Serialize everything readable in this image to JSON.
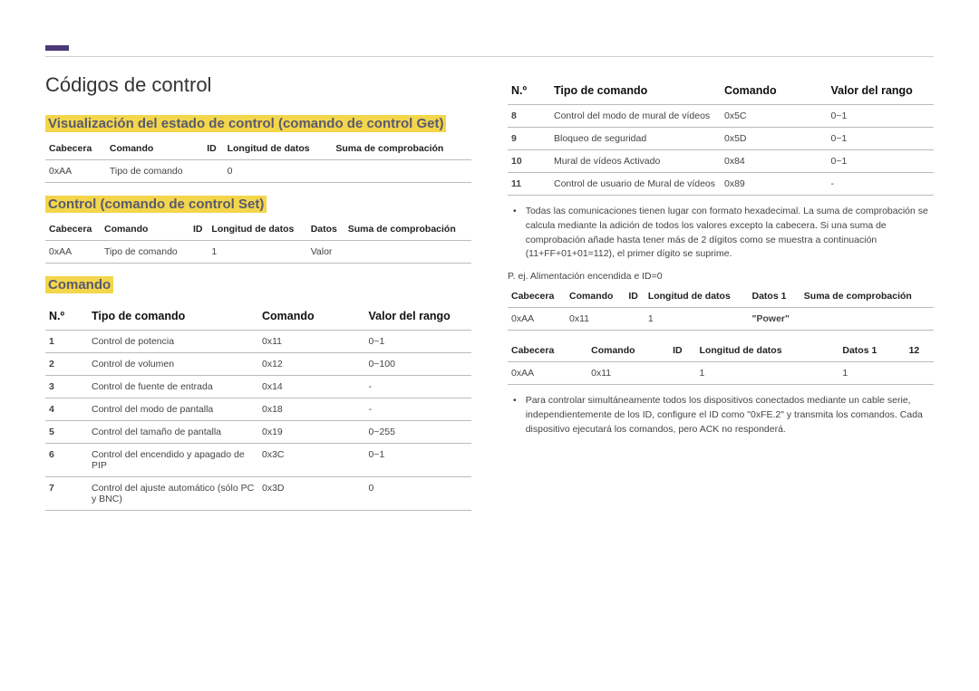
{
  "page_title": "Códigos de control",
  "section_get": {
    "title": "Visualización del estado de control (comando de control Get)",
    "headers": [
      "Cabecera",
      "Comando",
      "ID",
      "Longitud de datos",
      "Suma de comprobación"
    ],
    "row": [
      "0xAA",
      "Tipo de comando",
      "",
      "0",
      ""
    ]
  },
  "section_set": {
    "title": "Control (comando de control Set)",
    "headers": [
      "Cabecera",
      "Comando",
      "ID",
      "Longitud de datos",
      "Datos",
      "Suma de comprobación"
    ],
    "row": [
      "0xAA",
      "Tipo de comando",
      "",
      "1",
      "Valor",
      ""
    ]
  },
  "section_cmd": {
    "title": "Comando",
    "headers": {
      "no": "N.º",
      "tipo": "Tipo de comando",
      "cmd": "Comando",
      "rango": "Valor del rango"
    },
    "rows_left": [
      {
        "no": "1",
        "tipo": "Control de potencia",
        "cmd": "0x11",
        "rango": "0~1"
      },
      {
        "no": "2",
        "tipo": "Control de volumen",
        "cmd": "0x12",
        "rango": "0~100"
      },
      {
        "no": "3",
        "tipo": "Control de fuente de entrada",
        "cmd": "0x14",
        "rango": "-"
      },
      {
        "no": "4",
        "tipo": "Control del modo de pantalla",
        "cmd": "0x18",
        "rango": "-"
      },
      {
        "no": "5",
        "tipo": "Control del tamaño de pantalla",
        "cmd": "0x19",
        "rango": "0~255"
      },
      {
        "no": "6",
        "tipo": "Control del encendido y apagado de PIP",
        "cmd": "0x3C",
        "rango": "0~1"
      },
      {
        "no": "7",
        "tipo": "Control del ajuste automático (sólo PC y BNC)",
        "cmd": "0x3D",
        "rango": "0"
      }
    ],
    "rows_right": [
      {
        "no": "8",
        "tipo": "Control del modo de mural de vídeos",
        "cmd": "0x5C",
        "rango": "0~1"
      },
      {
        "no": "9",
        "tipo": "Bloqueo de seguridad",
        "cmd": "0x5D",
        "rango": "0~1"
      },
      {
        "no": "10",
        "tipo": "Mural de vídeos Activado",
        "cmd": "0x84",
        "rango": "0~1"
      },
      {
        "no": "11",
        "tipo": "Control de usuario de Mural de vídeos",
        "cmd": "0x89",
        "rango": "-"
      }
    ]
  },
  "note1": "Todas las comunicaciones tienen lugar con formato hexadecimal. La suma de comprobación se calcula mediante la adición de todos los valores excepto la cabecera. Si una suma de comprobación añade hasta tener más de 2 dígitos como se muestra a continuación (11+FF+01+01=112), el primer dígito se suprime.",
  "example_label": "P. ej. Alimentación encendida e ID=0",
  "table_ex1": {
    "headers": [
      "Cabecera",
      "Comando",
      "ID",
      "Longitud de datos",
      "Datos 1",
      "Suma de comprobación"
    ],
    "row": [
      "0xAA",
      "0x11",
      "",
      "1",
      "\"Power\"",
      ""
    ]
  },
  "table_ex2": {
    "headers": [
      "Cabecera",
      "Comando",
      "ID",
      "Longitud de datos",
      "Datos 1",
      "12"
    ],
    "row": [
      "0xAA",
      "0x11",
      "",
      "1",
      "1",
      ""
    ]
  },
  "note2": "Para controlar simultáneamente todos los dispositivos conectados mediante un cable serie, independientemente de los ID, configure el ID como \"0xFE.2\" y transmita los comandos. Cada dispositivo ejecutará los comandos, pero ACK no responderá.",
  "bullet_dot": "•"
}
